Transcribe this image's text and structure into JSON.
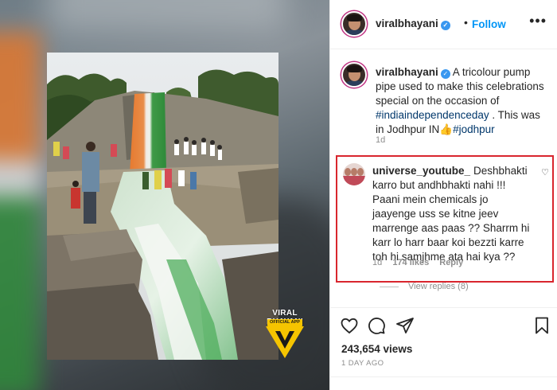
{
  "post": {
    "username": "viralbhayani",
    "follow_label": "Follow",
    "dot": "•",
    "more": "•••",
    "verified_glyph": "✓"
  },
  "caption": {
    "username": "viralbhayani",
    "body_pre": " A tricolour pump pipe used to make this celebrations special on the occasion of ",
    "hashtag1": "#indiaindependenceday",
    "body_mid": " . This was in Jodhpur IN👍",
    "hashtag2": "#jodhpur",
    "time": "1d"
  },
  "comment": {
    "username": "universe_youtube_",
    "text": "Deshbhakti karro but andhbhakti nahi !!! Paani mein chemicals jo jaayenge uss se kitne jeev marrenge aas paas ?? Sharrm hi karr lo harr baar koi bezzti karre toh hi samjhme ata hai kya ??",
    "time": "1d",
    "likes": "174 likes",
    "reply_label": "Reply",
    "heart": "♡"
  },
  "replies": {
    "label": "View replies (8)"
  },
  "engagement": {
    "views": "243,654 views",
    "posted": "1 DAY AGO"
  },
  "watermark": {
    "brand": "VIRAL BHAYANI",
    "tag": "OFFICIAL APP"
  },
  "colors": {
    "accent": "#0095f6",
    "highlight_box": "#d9262e",
    "brand_yellow": "#f5c400",
    "tricolor_saffron": "#e0772e",
    "tricolor_green": "#2f8a3a"
  }
}
